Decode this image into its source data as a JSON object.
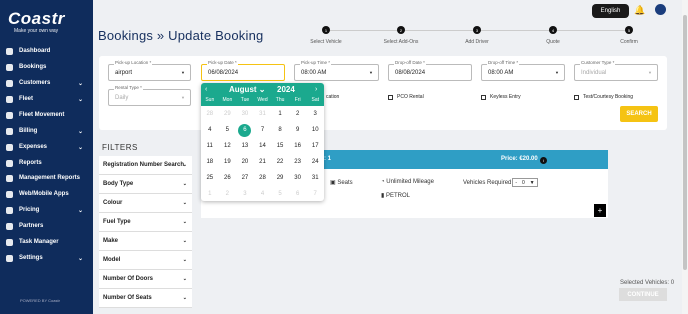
{
  "sidebar": {
    "logo": "Coastr",
    "tagline": "Make your own way",
    "powered": "POWERED BY Coastr",
    "items": [
      {
        "label": "Dashboard",
        "chev": false
      },
      {
        "label": "Bookings",
        "chev": false
      },
      {
        "label": "Customers",
        "chev": true
      },
      {
        "label": "Fleet",
        "chev": true
      },
      {
        "label": "Fleet Movement",
        "chev": false
      },
      {
        "label": "Billing",
        "chev": true
      },
      {
        "label": "Expenses",
        "chev": true
      },
      {
        "label": "Reports",
        "chev": false
      },
      {
        "label": "Management Reports",
        "chev": false
      },
      {
        "label": "Web/Mobile Apps",
        "chev": false
      },
      {
        "label": "Pricing",
        "chev": true
      },
      {
        "label": "Partners",
        "chev": false
      },
      {
        "label": "Task Manager",
        "chev": false
      },
      {
        "label": "Settings",
        "chev": true
      }
    ]
  },
  "topbar": {
    "language": "English"
  },
  "page": {
    "title": "Bookings  »  Update  Booking"
  },
  "steps": [
    {
      "num": "1",
      "label": "Select Vehicle"
    },
    {
      "num": "2",
      "label": "Select Add-Ons"
    },
    {
      "num": "3",
      "label": "Add Driver"
    },
    {
      "num": "4",
      "label": "Quote"
    },
    {
      "num": "5",
      "label": "Confirm"
    }
  ],
  "form": {
    "pickup_location": {
      "label": "Pick-up Location *",
      "value": "airport"
    },
    "pickup_date": {
      "label": "Pick-up Date *",
      "value": "06/08/2024"
    },
    "pickup_time": {
      "label": "Pick-up Time *",
      "value": "08:00 AM"
    },
    "dropoff_date": {
      "label": "Drop-off Date *",
      "value": "08/08/2024"
    },
    "dropoff_time": {
      "label": "Drop-off Time *",
      "value": "08:00 AM"
    },
    "customer_type": {
      "label": "Customer Type *",
      "value": "Individual"
    },
    "rental_type": {
      "label": "Rental Type *",
      "value": "Daily"
    },
    "checkbox_partial": "cation",
    "pco_rental": "PCO Rental",
    "keyless_entry": "Keyless Entry",
    "courtesy_booking": "Test/Courtesy Booking",
    "search": "SEARCH"
  },
  "calendar": {
    "month": "August",
    "year": "2024",
    "weekdays": [
      "Sun",
      "Mon",
      "Tue",
      "Wed",
      "Thu",
      "Fri",
      "Sat"
    ],
    "days": [
      [
        "28",
        1
      ],
      [
        "29",
        1
      ],
      [
        "30",
        1
      ],
      [
        "31",
        1
      ],
      [
        "1",
        0
      ],
      [
        "2",
        0
      ],
      [
        "3",
        0
      ],
      [
        "4",
        0
      ],
      [
        "5",
        0
      ],
      [
        "6",
        2
      ],
      [
        "7",
        0
      ],
      [
        "8",
        0
      ],
      [
        "9",
        0
      ],
      [
        "10",
        0
      ],
      [
        "11",
        0
      ],
      [
        "12",
        0
      ],
      [
        "13",
        0
      ],
      [
        "14",
        0
      ],
      [
        "15",
        0
      ],
      [
        "16",
        0
      ],
      [
        "17",
        0
      ],
      [
        "18",
        0
      ],
      [
        "19",
        0
      ],
      [
        "20",
        0
      ],
      [
        "21",
        0
      ],
      [
        "22",
        0
      ],
      [
        "23",
        0
      ],
      [
        "24",
        0
      ],
      [
        "25",
        0
      ],
      [
        "26",
        0
      ],
      [
        "27",
        0
      ],
      [
        "28",
        0
      ],
      [
        "29",
        0
      ],
      [
        "30",
        0
      ],
      [
        "31",
        0
      ],
      [
        "1",
        1
      ],
      [
        "2",
        1
      ],
      [
        "3",
        1
      ],
      [
        "4",
        1
      ],
      [
        "5",
        1
      ],
      [
        "6",
        1
      ],
      [
        "7",
        1
      ]
    ]
  },
  "filters": {
    "title": "FILTERS",
    "items": [
      "Registration Number Search",
      "Body Type",
      "Colour",
      "Fuel Type",
      "Make",
      "Model",
      "Number Of Doors",
      "Number Of Seats"
    ]
  },
  "vehicle": {
    "count": "le: 1",
    "price": "Price: €20.00",
    "seats": "Seats",
    "mileage": "Unlimited Mileage",
    "fuel": "PETROL",
    "required_label": "Vehicles Required",
    "qty": "0",
    "plus": "+"
  },
  "footer": {
    "selected": "Selected Vehicles: 0",
    "continue": "CONTINUE"
  }
}
